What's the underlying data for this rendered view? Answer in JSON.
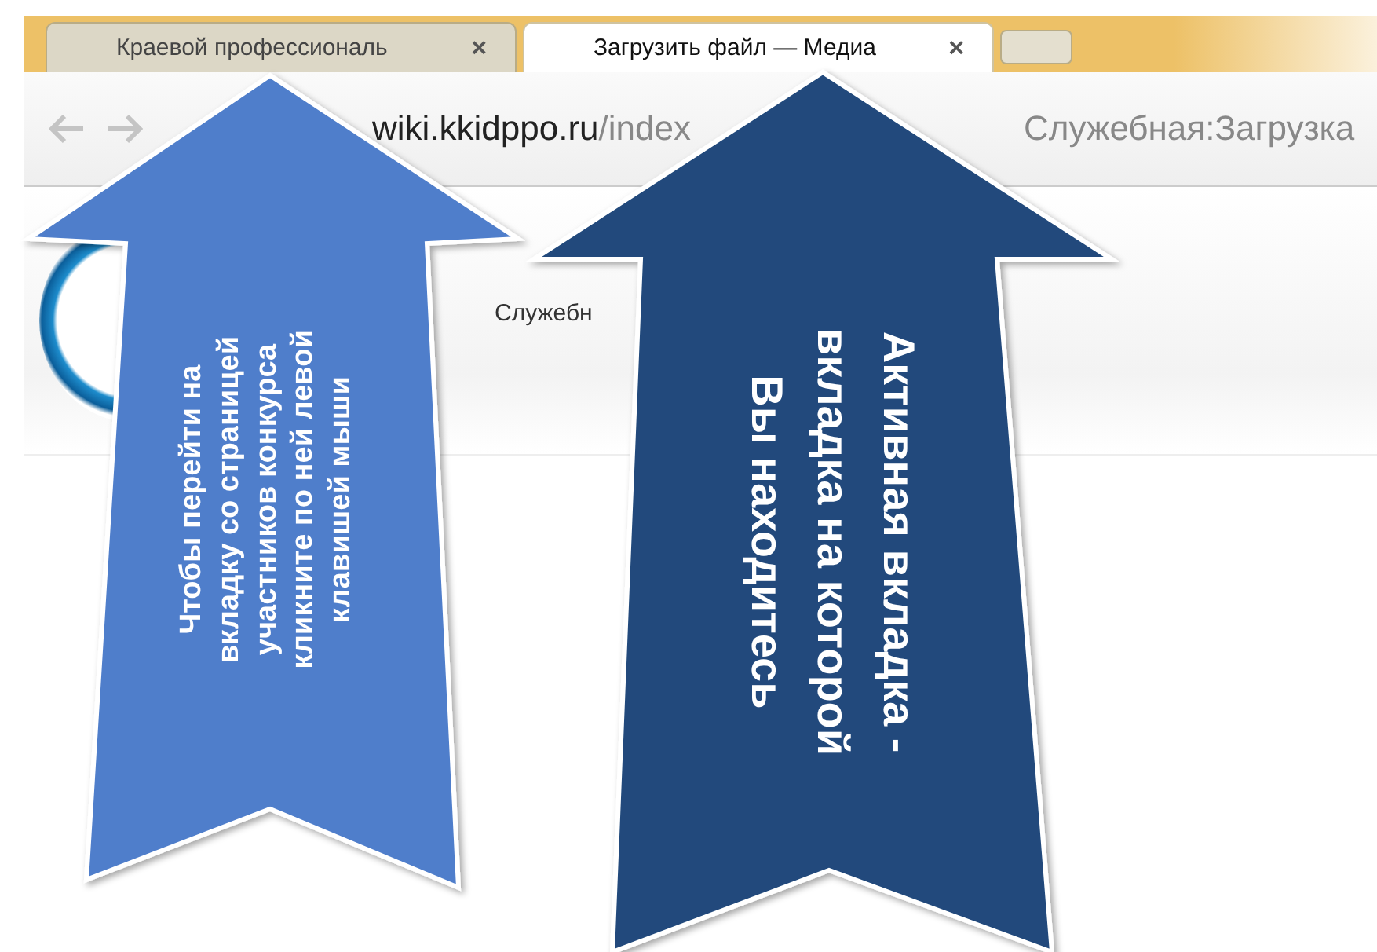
{
  "tabs": [
    {
      "title": "Краевой профессиональ",
      "close": "×",
      "selected": false
    },
    {
      "title": "Загрузить файл — Медиа",
      "close": "×",
      "selected": true
    }
  ],
  "address_bar": {
    "host": "wiki.kkidppo.ru",
    "path": "/index",
    "page": "Служебная:Загрузка"
  },
  "page": {
    "breadcrumb": "Служебн"
  },
  "callouts": [
    {
      "kind": "light",
      "text": "Чтобы перейти на вкладку со страницей участников конкурса кликните по ней левой клавишей мыши"
    },
    {
      "kind": "dark",
      "text": "Активная вкладка - вкладка на которой Вы находитесь"
    }
  ]
}
